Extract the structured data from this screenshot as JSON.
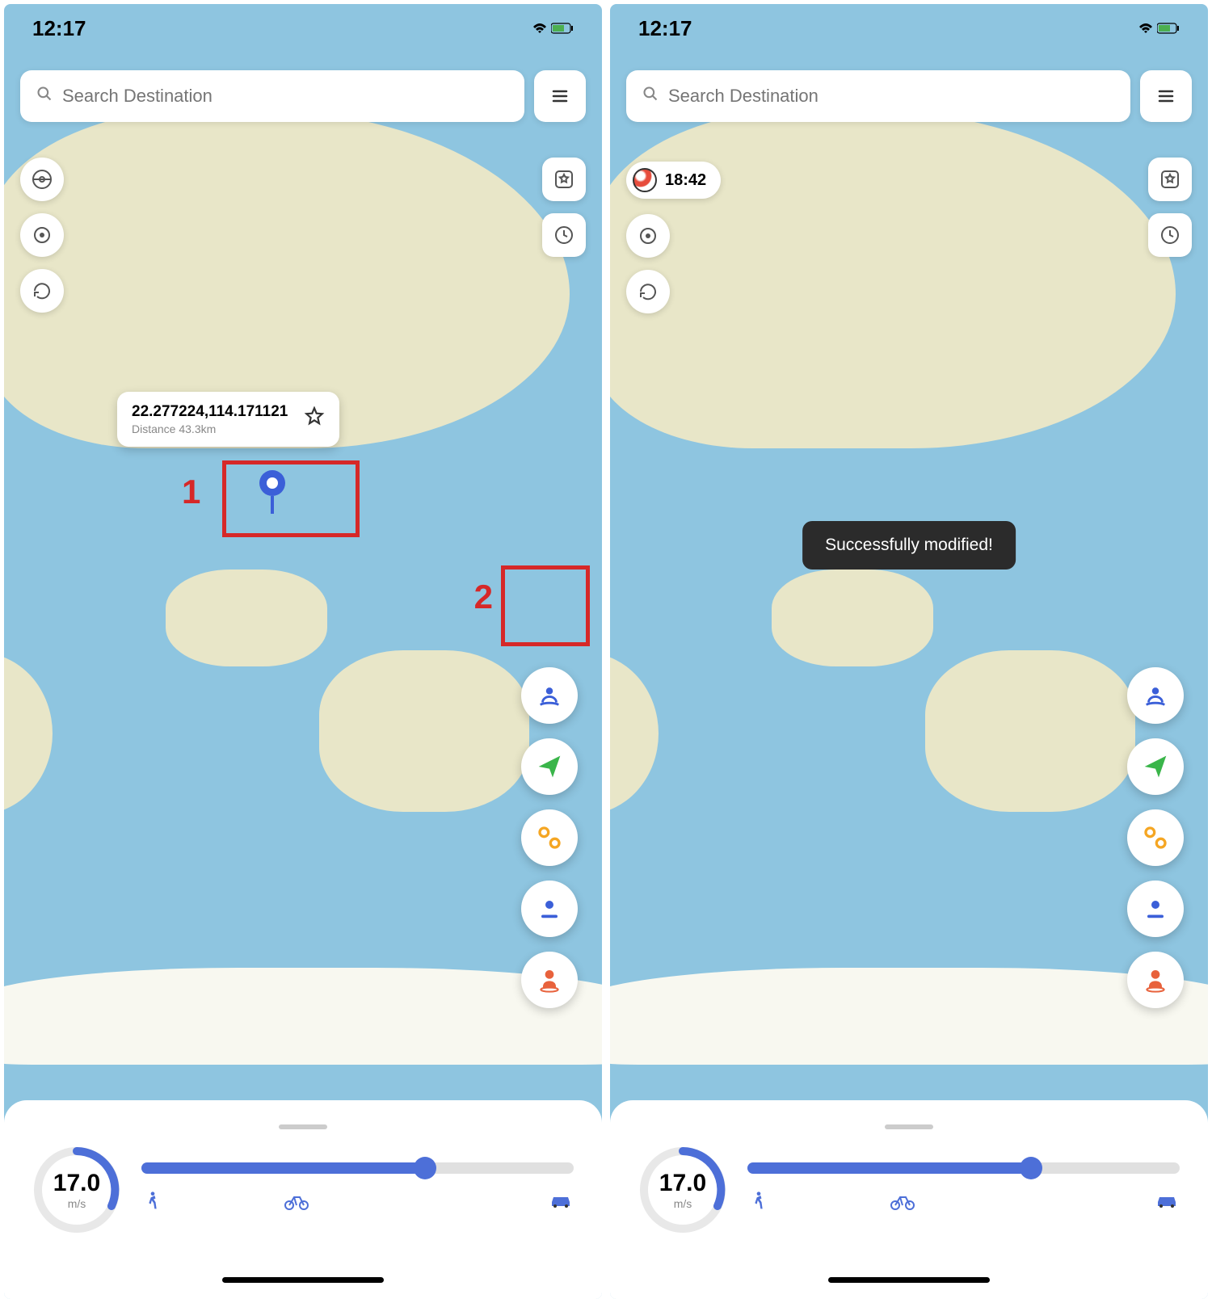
{
  "left": {
    "status": {
      "time": "12:17"
    },
    "search": {
      "placeholder": "Search Destination"
    },
    "popup": {
      "coords": "22.277224,114.171121",
      "distance": "Distance 43.3km"
    },
    "annotations": {
      "label1": "1",
      "label2": "2"
    },
    "speed": {
      "value": "17.0",
      "unit": "m/s"
    }
  },
  "right": {
    "status": {
      "time": "12:17"
    },
    "search": {
      "placeholder": "Search Destination"
    },
    "timer": {
      "value": "18:42"
    },
    "toast": "Successfully modified!",
    "speed": {
      "value": "17.0",
      "unit": "m/s"
    }
  }
}
